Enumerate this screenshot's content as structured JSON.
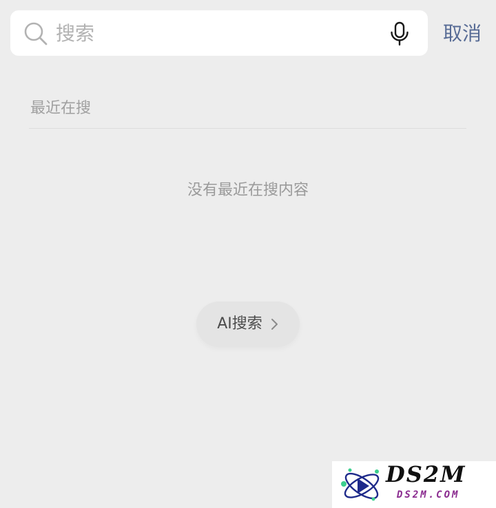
{
  "search": {
    "placeholder": "搜索",
    "value": ""
  },
  "header": {
    "cancel_label": "取消"
  },
  "recent": {
    "title": "最近在搜",
    "empty_text": "没有最近在搜内容"
  },
  "ai_search": {
    "label": "AI搜索"
  },
  "watermark": {
    "title": "DS2M",
    "subtitle": "DS2M.COM"
  },
  "colors": {
    "background": "#ededed",
    "accent": "#576b95",
    "placeholder": "#b2b2b2"
  },
  "icons": {
    "search": "search-icon",
    "mic": "mic-icon",
    "chevron": "chevron-right-icon",
    "logo": "atom-logo-icon"
  }
}
